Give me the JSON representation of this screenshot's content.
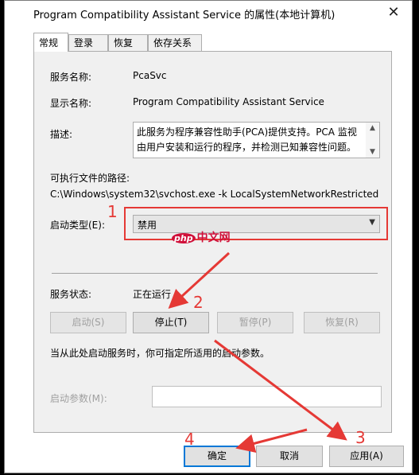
{
  "window": {
    "title": "Program Compatibility Assistant Service 的属性(本地计算机)",
    "close_glyph": "✕"
  },
  "tabs": [
    {
      "label": "常规",
      "active": true
    },
    {
      "label": "登录",
      "active": false
    },
    {
      "label": "恢复",
      "active": false
    },
    {
      "label": "依存关系",
      "active": false
    }
  ],
  "general": {
    "service_name_label": "服务名称:",
    "service_name_value": "PcaSvc",
    "display_name_label": "显示名称:",
    "display_name_value": "Program Compatibility Assistant Service",
    "description_label": "描述:",
    "description_value": "此服务为程序兼容性助手(PCA)提供支持。PCA 监视由用户安装和运行的程序，并检测已知兼容性问题。如果",
    "path_label": "可执行文件的路径:",
    "path_value": "C:\\Windows\\system32\\svchost.exe -k LocalSystemNetworkRestricted",
    "startup_type_label": "启动类型(E):",
    "startup_type_value": "禁用",
    "status_label": "服务状态:",
    "status_value": "正在运行",
    "hint": "当从此处启动服务时，你可指定所适用的启动参数。",
    "params_label": "启动参数(M):",
    "params_value": ""
  },
  "service_buttons": {
    "start": "启动(S)",
    "stop": "停止(T)",
    "pause": "暂停(P)",
    "resume": "恢复(R)"
  },
  "dialog_buttons": {
    "ok": "确定",
    "cancel": "取消",
    "apply": "应用(A)"
  },
  "annotations": {
    "step1": "1",
    "step2": "2",
    "step3": "3",
    "step4": "4",
    "color": "#e53935"
  },
  "watermark": {
    "logo": "php",
    "text": "中文网"
  }
}
